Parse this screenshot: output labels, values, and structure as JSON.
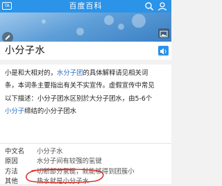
{
  "header": {
    "left_badge": "TA",
    "title": "百度百科",
    "search_icon": "search-icon",
    "user_icon": "user-icon",
    "bar_color": "#2b93e8"
  },
  "hero": {
    "edit_icon": "pencil-icon",
    "gallery_icon": "image-icon"
  },
  "entry": {
    "title": "小分子水",
    "audio_icon": "speaker-icon"
  },
  "summary": {
    "line1_pre": "小是和大相对的，",
    "line1_link": "水分子团",
    "line1_post": "的具体解释请见相关词",
    "line2": "条，本词条主要指出有关不实宣传。虚假宣传中常见",
    "line3": "以下描述：小分子团水区别於大分子团水，由5-6个",
    "line4_pre": "",
    "line4_link": "小分子",
    "line4_post": "缔结的小分子团水",
    "link_color": "#2f6fc0"
  },
  "infobox": {
    "rows": [
      {
        "key": "中文名",
        "value": "小分子水",
        "link": ""
      },
      {
        "key": "原因",
        "value_link": "水分子",
        "value": "间有较强的氢键"
      },
      {
        "key": "方法",
        "value": "切断部分氢键，就能够得到",
        "value_link": "团簇小"
      },
      {
        "key": "其他",
        "value": "热水就是小分子水"
      }
    ],
    "annotation_color": "#d9342b"
  }
}
